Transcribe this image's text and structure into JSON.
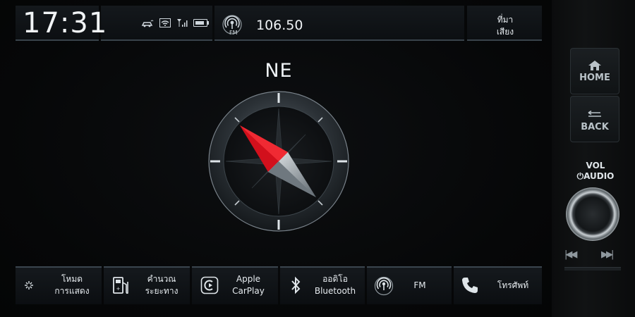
{
  "status_bar": {
    "time": "17:31",
    "icons": [
      "car-connect-icon",
      "wifi-icon",
      "signal-icon",
      "battery-icon"
    ],
    "radio_band": "FM",
    "frequency": "106.50",
    "source_label_line1": "ที่มา",
    "source_label_line2": "เสียง"
  },
  "compass": {
    "heading": "NE",
    "needle_degrees": 45
  },
  "bottom_bar": [
    {
      "id": "display-mode",
      "icon": "day-night-icon",
      "line1": "โหมด",
      "line2": "การแสดง"
    },
    {
      "id": "trip-calculator",
      "icon": "fuel-pump-icon",
      "line1": "คำนวณ",
      "line2": "ระยะทาง"
    },
    {
      "id": "apple-carplay",
      "icon": "carplay-icon",
      "line1": "Apple",
      "line2": "CarPlay"
    },
    {
      "id": "bluetooth-audio",
      "icon": "bluetooth-icon",
      "line1": "ออดิโอ",
      "line2": "Bluetooth"
    },
    {
      "id": "fm",
      "icon": "radio-icon",
      "line1": "FM",
      "line2": ""
    },
    {
      "id": "phone",
      "icon": "phone-icon",
      "line1": "โทรศัพท์",
      "line2": ""
    }
  ],
  "hardware": {
    "home_label": "HOME",
    "back_label": "BACK",
    "vol_label": "VOL",
    "audio_label": "AUDIO"
  },
  "colors": {
    "background": "#050607",
    "needle_red": "#d2101c",
    "accent_line": "#39434b"
  }
}
